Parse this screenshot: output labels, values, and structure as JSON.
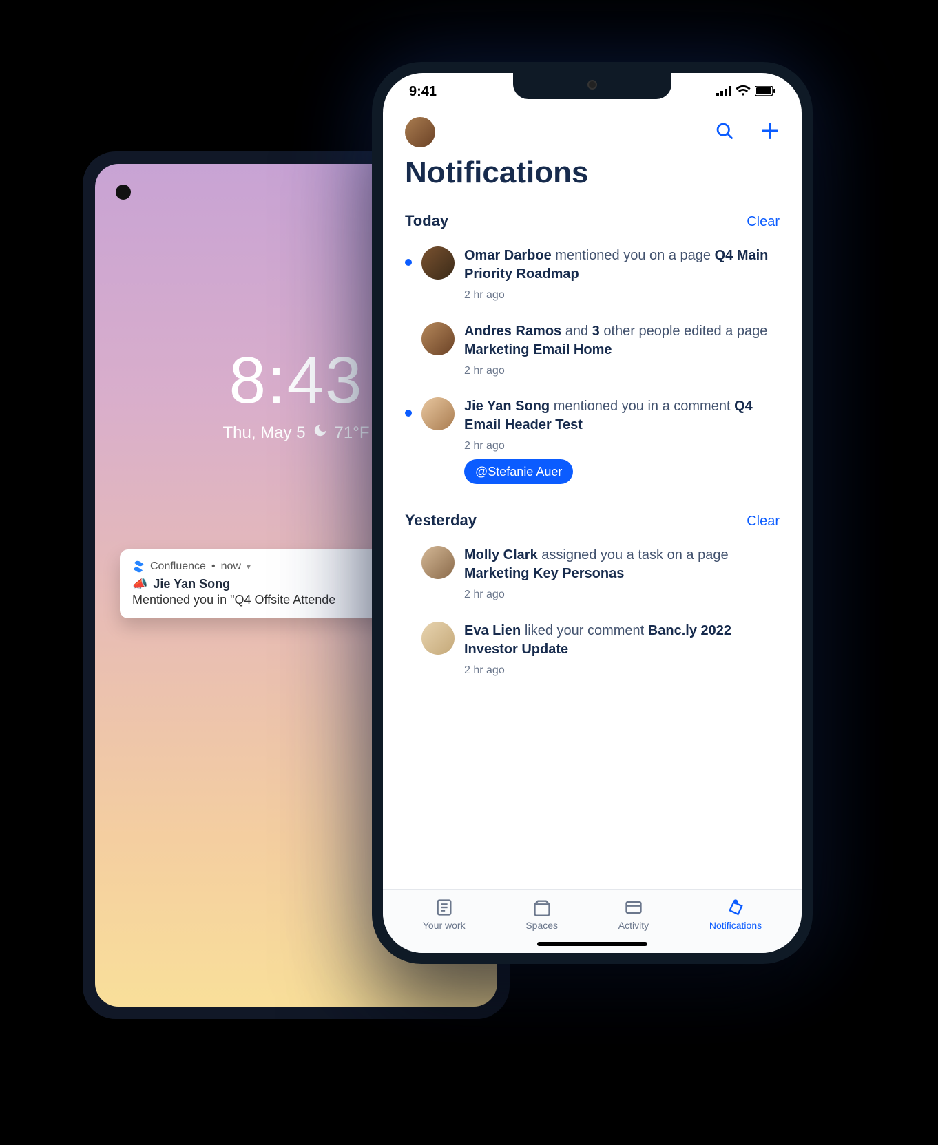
{
  "android": {
    "clock_time": "8:43",
    "date": "Thu, May 5",
    "temp": "71°F",
    "notification": {
      "app_name": "Confluence",
      "time_label": "now",
      "author": "Jie Yan Song",
      "body": "Mentioned you in \"Q4 Offsite Attende"
    }
  },
  "ios": {
    "status_time": "9:41",
    "page_title": "Notifications",
    "sections": [
      {
        "title": "Today",
        "clear_label": "Clear",
        "items": [
          {
            "unread": true,
            "avatar": "av-1",
            "prefix": "Omar Darboe",
            "middle": "mentioned you on a page",
            "count": "",
            "title": "Q4 Main Priority Roadmap",
            "time": "2 hr ago",
            "mention": ""
          },
          {
            "unread": false,
            "avatar": "av-2",
            "prefix": "Andres Ramos",
            "middle": "and",
            "count": "3",
            "middle2": "other people edited a page",
            "title": "Marketing Email Home",
            "time": "2 hr ago",
            "mention": ""
          },
          {
            "unread": true,
            "avatar": "av-3",
            "prefix": "Jie Yan Song",
            "middle": "mentioned you in a comment",
            "count": "",
            "title": "Q4 Email Header Test",
            "time": "2 hr ago",
            "mention": "@Stefanie Auer"
          }
        ]
      },
      {
        "title": "Yesterday",
        "clear_label": "Clear",
        "items": [
          {
            "unread": false,
            "avatar": "av-4",
            "prefix": "Molly Clark",
            "middle": "assigned you a task on a page",
            "count": "",
            "title": "Marketing Key Personas",
            "time": "2 hr ago",
            "mention": ""
          },
          {
            "unread": false,
            "avatar": "av-5",
            "prefix": "Eva Lien",
            "middle": "liked your comment",
            "count": "",
            "title": "Banc.ly 2022 Investor Update",
            "time": "2 hr ago",
            "mention": ""
          }
        ]
      }
    ],
    "tabs": [
      {
        "label": "Your work",
        "active": false
      },
      {
        "label": "Spaces",
        "active": false
      },
      {
        "label": "Activity",
        "active": false
      },
      {
        "label": "Notifications",
        "active": true
      }
    ]
  }
}
